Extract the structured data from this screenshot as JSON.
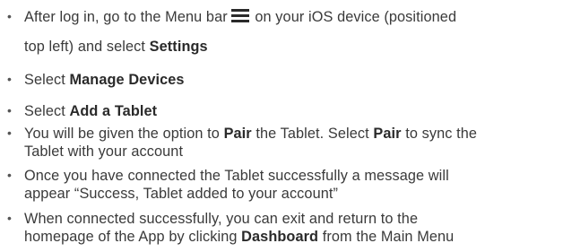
{
  "bullet_glyph": "•",
  "menu_icon": "hamburger-menu-icon",
  "steps": [
    {
      "line1_a": "After log in, go to the Menu bar",
      "line1_b": "on your iOS device (positioned",
      "line2_a": "top left) and select",
      "line2_bold": "Settings"
    },
    {
      "prefix": "Select",
      "bold": "Manage Devices"
    },
    {
      "prefix": "Select",
      "bold": "Add a Tablet"
    },
    {
      "line1_a": "You will be given the option to",
      "line1_bold1": "Pair",
      "line1_b": "the Tablet. Select",
      "line1_bold2": "Pair",
      "line1_c": "to sync the",
      "line2": "Tablet with your account"
    },
    {
      "line1": "Once you have connected the Tablet successfully a message will",
      "line2": "appear “Success, Tablet added to your account”"
    },
    {
      "line1": "When connected successfully, you can exit and return to the",
      "line2_a": "homepage of the App by clicking",
      "line2_bold": "Dashboard",
      "line2_b": "from the Main Menu"
    }
  ]
}
